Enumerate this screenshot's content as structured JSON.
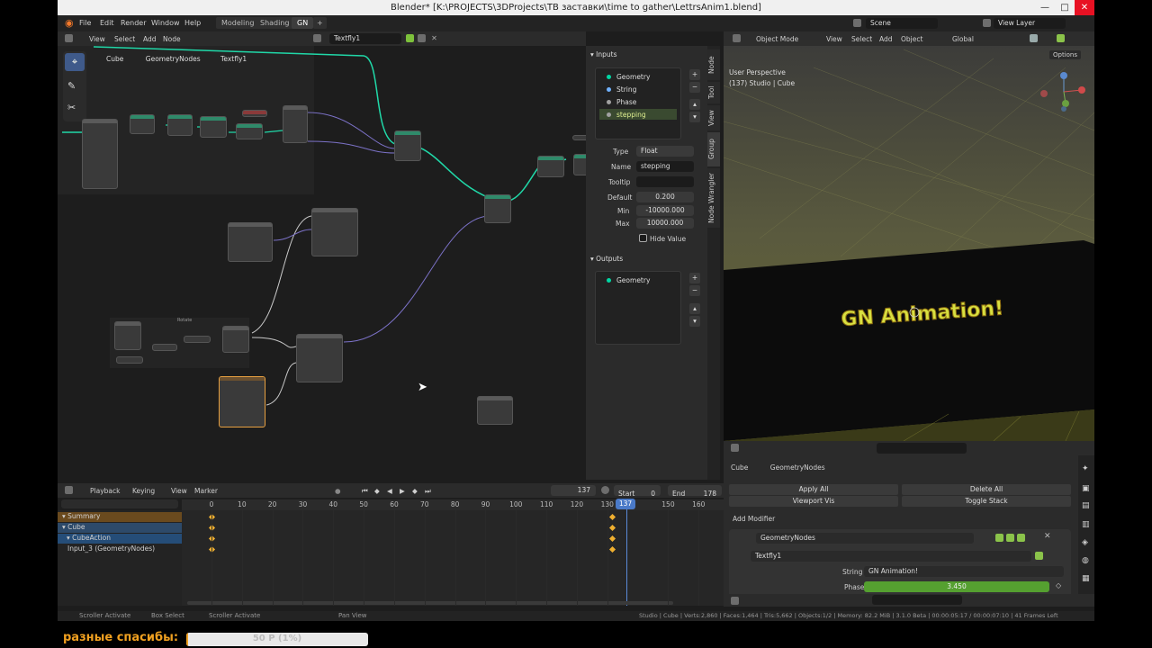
{
  "window": {
    "title": "Blender* [K:\\PROJECTS\\3DProjects\\ТВ заставки\\time to gather\\LettrsAnim1.blend]"
  },
  "menu": {
    "items": [
      "File",
      "Edit",
      "Render",
      "Window",
      "Help"
    ],
    "workspaces": [
      "Modeling",
      "Shading",
      "GN"
    ],
    "scene": "Scene",
    "view_layer": "View Layer"
  },
  "node_editor": {
    "header": [
      "View",
      "Select",
      "Add",
      "Node"
    ],
    "node_group": "Textfly1",
    "breadcrumb": [
      "Cube",
      "GeometryNodes",
      "Textfly1"
    ],
    "frame_label": "Rotate"
  },
  "npanel": {
    "tabs": [
      "Node",
      "Tool",
      "View",
      "Group",
      "Node Wrangler"
    ],
    "inputs_title": "Inputs",
    "inputs": [
      {
        "name": "Geometry",
        "color": "#00d6a3"
      },
      {
        "name": "String",
        "color": "#70b2ff"
      },
      {
        "name": "Phase",
        "color": "#a1a1a1"
      },
      {
        "name": "stepping",
        "color": "#a1a1a1"
      }
    ],
    "props": {
      "type_label": "Type",
      "type_value": "Float",
      "name_label": "Name",
      "name_value": "stepping",
      "tooltip_label": "Tooltip",
      "tooltip_value": "",
      "default_label": "Default",
      "default_value": "0.200",
      "min_label": "Min",
      "min_value": "-10000.000",
      "max_label": "Max",
      "max_value": "10000.000",
      "hide_value": "Hide Value"
    },
    "outputs_title": "Outputs",
    "outputs": [
      {
        "name": "Geometry",
        "color": "#00d6a3"
      }
    ]
  },
  "viewport": {
    "header": [
      "Object Mode",
      "View",
      "Select",
      "Add",
      "Object",
      "Global"
    ],
    "options": "Options",
    "perspective": "User Perspective",
    "object_info": "(137) Studio | Cube",
    "text_3d": "GN Animation!"
  },
  "timeline": {
    "header": [
      "Playback",
      "Keying",
      "View",
      "Marker"
    ],
    "current_frame": "137",
    "start_label": "Start",
    "start": "0",
    "end_label": "End",
    "end": "178",
    "ticks": [
      "0",
      "10",
      "20",
      "30",
      "40",
      "50",
      "60",
      "70",
      "80",
      "90",
      "100",
      "110",
      "120",
      "130",
      "137",
      "150",
      "160"
    ],
    "channels": [
      {
        "name": "Summary",
        "color": "#6a4a1e"
      },
      {
        "name": "Cube",
        "color": "#2d4a6a"
      },
      {
        "name": "CubeAction",
        "color": "#254d78"
      },
      {
        "name": "Input_3 (GeometryNodes)",
        "color": "transparent"
      }
    ]
  },
  "properties": {
    "breadcrumb": [
      "Cube",
      "GeometryNodes"
    ],
    "apply_all": "Apply All",
    "delete_all": "Delete All",
    "viewport_vis": "Viewport Vis",
    "toggle_stack": "Toggle Stack",
    "add_modifier": "Add Modifier",
    "modifier_name": "GeometryNodes",
    "node_group": "Textfly1",
    "string_label": "String",
    "string_value": "GN Animation!",
    "phase_label": "Phase",
    "phase_value": "3.450"
  },
  "status": {
    "items": [
      "Scroller Activate",
      "Box Select",
      "Scroller Activate",
      "Pan View"
    ],
    "stats": "Studio | Cube | Verts:2,860 | Faces:1,464 | Tris:5,662 | Objects:1/2 | Memory: 82.2 MiB | 3.1.0 Beta | 00:00:05:17 / 00:00:07:10 | 41 Frames Left"
  },
  "overlay": {
    "caption": "разные спасибы:",
    "progress_text": "50 Р (1%)",
    "progress_fraction": 0.01
  }
}
